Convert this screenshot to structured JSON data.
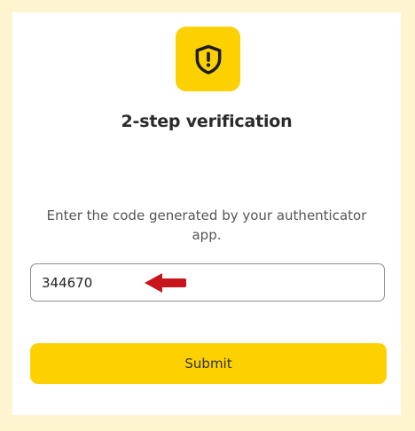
{
  "header": {
    "icon": "shield-alert-icon",
    "title": "2-step verification"
  },
  "form": {
    "instruction": "Enter the code generated by your authenticator app.",
    "code_value": "344670",
    "submit_label": "Submit"
  },
  "annotation": {
    "arrow_icon": "red-arrow-left-icon"
  },
  "colors": {
    "accent": "#fdd000",
    "background": "#fef4cf",
    "arrow": "#c8141c"
  }
}
